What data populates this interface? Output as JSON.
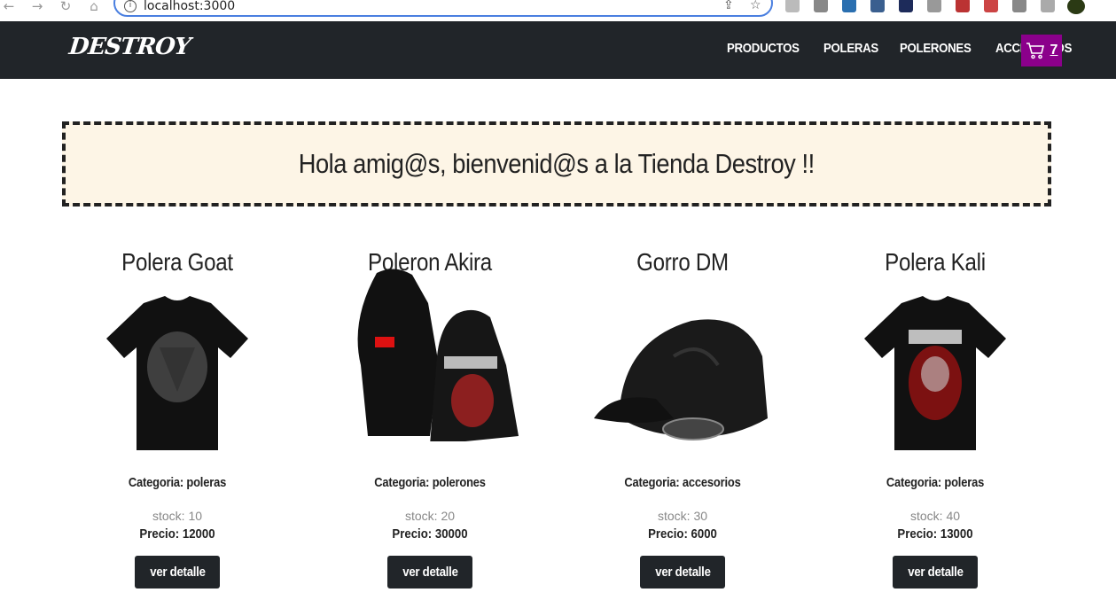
{
  "browser": {
    "url": "localhost:3000"
  },
  "navbar": {
    "brand": "DESTROY",
    "links": [
      "PRODUCTOS",
      "POLERAS",
      "POLERONES",
      "ACCESORIOS"
    ],
    "cart_count": "7",
    "cart_color": "#8b008b",
    "bg_color": "#212529"
  },
  "banner": {
    "text": "Hola amig@s, bienvenid@s a la Tienda Destroy !!",
    "bg_color": "#fdf5e6"
  },
  "products": [
    {
      "name": "Polera Goat",
      "category": "Categoria: poleras",
      "stock": "stock: 10",
      "price": "Precio: 12000",
      "button": "ver detalle",
      "image": "black-tshirt-goat"
    },
    {
      "name": "Poleron Akira",
      "category": "Categoria: polerones",
      "stock": "stock: 20",
      "price": "Precio: 30000",
      "button": "ver detalle",
      "image": "black-hoodie-akira"
    },
    {
      "name": "Gorro DM",
      "category": "Categoria: accesorios",
      "stock": "stock: 30",
      "price": "Precio: 6000",
      "button": "ver detalle",
      "image": "black-cap"
    },
    {
      "name": "Polera Kali",
      "category": "Categoria: poleras",
      "stock": "stock: 40",
      "price": "Precio: 13000",
      "button": "ver detalle",
      "image": "black-tshirt-kali"
    }
  ]
}
